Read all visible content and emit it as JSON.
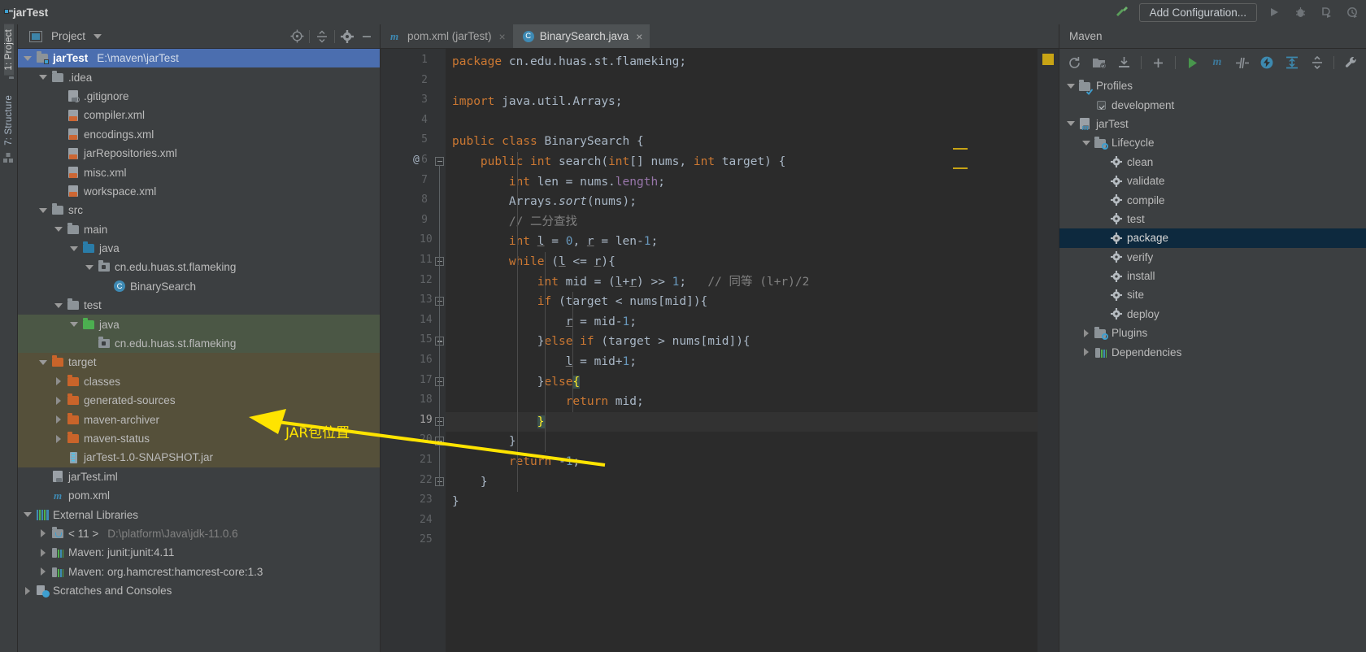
{
  "titlebar": {
    "project_name": "jarTest",
    "add_configuration_label": "Add Configuration...",
    "icons": [
      "build-hammer-icon",
      "run-icon",
      "debug-icon",
      "run-with-coverage-icon",
      "profiler-icon"
    ]
  },
  "left_strip": {
    "tabs": [
      {
        "label": "1: Project",
        "active": true
      },
      {
        "label": "7: Structure",
        "active": false
      }
    ]
  },
  "project_panel": {
    "title": "Project",
    "toolbar_icons": [
      "locate-target-icon",
      "collapse-all-icon",
      "settings-gear-icon",
      "hide-minus-icon"
    ],
    "tree": [
      {
        "depth": 0,
        "twisty": "down",
        "icon": "module-folder-icon",
        "label": "jarTest",
        "sub": "E:\\maven\\jarTest",
        "selected": true,
        "bold": true
      },
      {
        "depth": 1,
        "twisty": "down",
        "icon": "folder-icon",
        "label": ".idea",
        "sub": ""
      },
      {
        "depth": 2,
        "twisty": "none",
        "icon": "gitignore-file-icon",
        "label": ".gitignore",
        "sub": ""
      },
      {
        "depth": 2,
        "twisty": "none",
        "icon": "xml-file-icon",
        "label": "compiler.xml",
        "sub": ""
      },
      {
        "depth": 2,
        "twisty": "none",
        "icon": "xml-file-icon",
        "label": "encodings.xml",
        "sub": ""
      },
      {
        "depth": 2,
        "twisty": "none",
        "icon": "xml-file-icon",
        "label": "jarRepositories.xml",
        "sub": ""
      },
      {
        "depth": 2,
        "twisty": "none",
        "icon": "xml-file-icon",
        "label": "misc.xml",
        "sub": ""
      },
      {
        "depth": 2,
        "twisty": "none",
        "icon": "xml-file-icon",
        "label": "workspace.xml",
        "sub": ""
      },
      {
        "depth": 1,
        "twisty": "down",
        "icon": "folder-icon",
        "label": "src",
        "sub": ""
      },
      {
        "depth": 2,
        "twisty": "down",
        "icon": "folder-icon",
        "label": "main",
        "sub": ""
      },
      {
        "depth": 3,
        "twisty": "down",
        "icon": "source-root-folder-icon",
        "label": "java",
        "sub": ""
      },
      {
        "depth": 4,
        "twisty": "down",
        "icon": "package-icon",
        "label": "cn.edu.huas.st.flameking",
        "sub": ""
      },
      {
        "depth": 5,
        "twisty": "none",
        "icon": "java-class-icon",
        "label": "BinarySearch",
        "sub": ""
      },
      {
        "depth": 2,
        "twisty": "down",
        "icon": "folder-icon",
        "label": "test",
        "sub": ""
      },
      {
        "depth": 3,
        "twisty": "down",
        "icon": "test-source-root-folder-icon",
        "label": "java",
        "sub": "",
        "highlight": "green"
      },
      {
        "depth": 4,
        "twisty": "none",
        "icon": "package-icon",
        "label": "cn.edu.huas.st.flameking",
        "sub": "",
        "highlight": "green"
      },
      {
        "depth": 1,
        "twisty": "down",
        "icon": "excluded-folder-icon",
        "label": "target",
        "sub": "",
        "highlight": "brown"
      },
      {
        "depth": 2,
        "twisty": "right",
        "icon": "excluded-folder-icon",
        "label": "classes",
        "sub": "",
        "highlight": "brown"
      },
      {
        "depth": 2,
        "twisty": "right",
        "icon": "excluded-folder-icon",
        "label": "generated-sources",
        "sub": "",
        "highlight": "brown"
      },
      {
        "depth": 2,
        "twisty": "right",
        "icon": "excluded-folder-icon",
        "label": "maven-archiver",
        "sub": "",
        "highlight": "brown"
      },
      {
        "depth": 2,
        "twisty": "right",
        "icon": "excluded-folder-icon",
        "label": "maven-status",
        "sub": "",
        "highlight": "brown"
      },
      {
        "depth": 2,
        "twisty": "none",
        "icon": "jar-file-icon",
        "label": "jarTest-1.0-SNAPSHOT.jar",
        "sub": "",
        "highlight": "brown"
      },
      {
        "depth": 1,
        "twisty": "none",
        "icon": "iml-module-file-icon",
        "label": "jarTest.iml",
        "sub": ""
      },
      {
        "depth": 1,
        "twisty": "none",
        "icon": "maven-pom-icon",
        "label": "pom.xml",
        "sub": ""
      },
      {
        "depth": 0,
        "twisty": "down",
        "icon": "external-libraries-icon",
        "label": "External Libraries",
        "sub": ""
      },
      {
        "depth": 1,
        "twisty": "right",
        "icon": "jdk-icon",
        "label": "< 11 >",
        "sub": "D:\\platform\\Java\\jdk-11.0.6"
      },
      {
        "depth": 1,
        "twisty": "right",
        "icon": "maven-library-icon",
        "label": "Maven: junit:junit:4.11",
        "sub": ""
      },
      {
        "depth": 1,
        "twisty": "right",
        "icon": "maven-library-icon",
        "label": "Maven: org.hamcrest:hamcrest-core:1.3",
        "sub": ""
      },
      {
        "depth": 0,
        "twisty": "right",
        "icon": "scratches-icon",
        "label": "Scratches and Consoles",
        "sub": ""
      }
    ]
  },
  "annotation": {
    "text": "JAR包位置",
    "color": "#ffe400"
  },
  "editor": {
    "tabs": [
      {
        "label": "pom.xml (jarTest)",
        "icon": "maven-pom-icon",
        "active": false,
        "close": "×"
      },
      {
        "label": "BinarySearch.java",
        "icon": "java-class-icon",
        "active": true,
        "close": "×"
      }
    ],
    "current_line": 19,
    "line_numbers": [
      1,
      2,
      3,
      4,
      5,
      6,
      7,
      8,
      9,
      10,
      11,
      12,
      13,
      14,
      15,
      16,
      17,
      18,
      19,
      20,
      21,
      22,
      23,
      24,
      25
    ],
    "gutter_annotation_line": 6,
    "gutter_annotation_glyph": "@",
    "fold_lines": [
      6,
      11,
      13,
      15,
      17,
      19,
      20,
      22
    ],
    "code_lines": [
      {
        "n": 1,
        "tokens": [
          {
            "t": "package ",
            "c": "k"
          },
          {
            "t": "cn.edu.huas.st.flameking;",
            "c": "id"
          }
        ]
      },
      {
        "n": 2,
        "tokens": []
      },
      {
        "n": 3,
        "tokens": [
          {
            "t": "import ",
            "c": "k"
          },
          {
            "t": "java.util.Arrays;",
            "c": "id"
          }
        ]
      },
      {
        "n": 4,
        "tokens": []
      },
      {
        "n": 5,
        "tokens": [
          {
            "t": "public class ",
            "c": "k"
          },
          {
            "t": "BinarySearch",
            "c": "cls"
          },
          {
            "t": " {",
            "c": "id"
          }
        ]
      },
      {
        "n": 6,
        "tokens": [
          {
            "t": "    public int ",
            "c": "k"
          },
          {
            "t": "search",
            "c": "cls"
          },
          {
            "t": "(",
            "c": "id"
          },
          {
            "t": "int",
            "c": "k"
          },
          {
            "t": "[] nums, ",
            "c": "id"
          },
          {
            "t": "int",
            "c": "k"
          },
          {
            "t": " target) {",
            "c": "id"
          }
        ]
      },
      {
        "n": 7,
        "tokens": [
          {
            "t": "        int",
            "c": "k"
          },
          {
            "t": " len = nums.",
            "c": "id"
          },
          {
            "t": "length",
            "c": "fld"
          },
          {
            "t": ";",
            "c": "id"
          }
        ]
      },
      {
        "n": 8,
        "tokens": [
          {
            "t": "        Arrays.",
            "c": "id"
          },
          {
            "t": "sort",
            "c": "id-italic"
          },
          {
            "t": "(nums);",
            "c": "id"
          }
        ]
      },
      {
        "n": 9,
        "tokens": [
          {
            "t": "        // 二分查找",
            "c": "cm"
          }
        ]
      },
      {
        "n": 10,
        "tokens": [
          {
            "t": "        int",
            "c": "k"
          },
          {
            "t": " ",
            "c": "id"
          },
          {
            "t": "l",
            "c": "u"
          },
          {
            "t": " = ",
            "c": "id"
          },
          {
            "t": "0",
            "c": "num"
          },
          {
            "t": ", ",
            "c": "id"
          },
          {
            "t": "r",
            "c": "u"
          },
          {
            "t": " = len-",
            "c": "id"
          },
          {
            "t": "1",
            "c": "num"
          },
          {
            "t": ";",
            "c": "id"
          }
        ]
      },
      {
        "n": 11,
        "tokens": [
          {
            "t": "        while",
            "c": "k"
          },
          {
            "t": " (",
            "c": "id"
          },
          {
            "t": "l",
            "c": "u"
          },
          {
            "t": " <= ",
            "c": "id"
          },
          {
            "t": "r",
            "c": "u"
          },
          {
            "t": "){",
            "c": "id"
          }
        ]
      },
      {
        "n": 12,
        "tokens": [
          {
            "t": "            int",
            "c": "k"
          },
          {
            "t": " mid = (",
            "c": "id"
          },
          {
            "t": "l",
            "c": "u"
          },
          {
            "t": "+",
            "c": "id"
          },
          {
            "t": "r",
            "c": "u"
          },
          {
            "t": ") >> ",
            "c": "id"
          },
          {
            "t": "1",
            "c": "num"
          },
          {
            "t": ";   ",
            "c": "id"
          },
          {
            "t": "// 同等 (l+r)/2",
            "c": "cm"
          }
        ]
      },
      {
        "n": 13,
        "tokens": [
          {
            "t": "            if",
            "c": "k"
          },
          {
            "t": " (target < nums[mid]){",
            "c": "id"
          }
        ]
      },
      {
        "n": 14,
        "tokens": [
          {
            "t": "                ",
            "c": "id"
          },
          {
            "t": "r",
            "c": "u"
          },
          {
            "t": " = mid-",
            "c": "id"
          },
          {
            "t": "1",
            "c": "num"
          },
          {
            "t": ";",
            "c": "id"
          }
        ]
      },
      {
        "n": 15,
        "tokens": [
          {
            "t": "            }",
            "c": "id"
          },
          {
            "t": "else if",
            "c": "k"
          },
          {
            "t": " (target > nums[mid]){",
            "c": "id"
          }
        ]
      },
      {
        "n": 16,
        "tokens": [
          {
            "t": "                ",
            "c": "id"
          },
          {
            "t": "l",
            "c": "u"
          },
          {
            "t": " = mid+",
            "c": "id"
          },
          {
            "t": "1",
            "c": "num"
          },
          {
            "t": ";",
            "c": "id"
          }
        ]
      },
      {
        "n": 17,
        "tokens": [
          {
            "t": "            }",
            "c": "id"
          },
          {
            "t": "else",
            "c": "k"
          },
          {
            "t": "{",
            "c": "bh"
          }
        ]
      },
      {
        "n": 18,
        "tokens": [
          {
            "t": "                return",
            "c": "k"
          },
          {
            "t": " mid;",
            "c": "id"
          }
        ]
      },
      {
        "n": 19,
        "tokens": [
          {
            "t": "            ",
            "c": "id"
          },
          {
            "t": "}",
            "c": "bh"
          }
        ]
      },
      {
        "n": 20,
        "tokens": [
          {
            "t": "        }",
            "c": "id"
          }
        ]
      },
      {
        "n": 21,
        "tokens": [
          {
            "t": "        return",
            "c": "k"
          },
          {
            "t": " -",
            "c": "id"
          },
          {
            "t": "1",
            "c": "num"
          },
          {
            "t": ";",
            "c": "id"
          }
        ]
      },
      {
        "n": 22,
        "tokens": [
          {
            "t": "    }",
            "c": "id"
          }
        ]
      },
      {
        "n": 23,
        "tokens": [
          {
            "t": "}",
            "c": "id"
          }
        ]
      },
      {
        "n": 24,
        "tokens": []
      },
      {
        "n": 25,
        "tokens": []
      }
    ]
  },
  "maven_panel": {
    "title": "Maven",
    "toolbar_icons": [
      "reload-icon",
      "add-managed-project-icon",
      "download-sources-icon",
      "plus-icon",
      "execute-goal-icon",
      "maven-m-icon",
      "toggle-skip-tests-icon",
      "offline-mode-icon",
      "expand-all-icon",
      "collapse-all-icon",
      "settings-wrench-icon"
    ],
    "tree": [
      {
        "depth": 0,
        "twisty": "down",
        "icon": "profiles-folder-icon",
        "label": "Profiles"
      },
      {
        "depth": 1,
        "twisty": "none",
        "icon": "checkbox-checked-icon",
        "label": "development"
      },
      {
        "depth": 0,
        "twisty": "down",
        "icon": "maven-project-icon",
        "label": "jarTest"
      },
      {
        "depth": 1,
        "twisty": "down",
        "icon": "lifecycle-folder-icon",
        "label": "Lifecycle"
      },
      {
        "depth": 2,
        "twisty": "none",
        "icon": "goal-gear-icon",
        "label": "clean"
      },
      {
        "depth": 2,
        "twisty": "none",
        "icon": "goal-gear-icon",
        "label": "validate"
      },
      {
        "depth": 2,
        "twisty": "none",
        "icon": "goal-gear-icon",
        "label": "compile"
      },
      {
        "depth": 2,
        "twisty": "none",
        "icon": "goal-gear-icon",
        "label": "test"
      },
      {
        "depth": 2,
        "twisty": "none",
        "icon": "goal-gear-icon",
        "label": "package",
        "selected": true
      },
      {
        "depth": 2,
        "twisty": "none",
        "icon": "goal-gear-icon",
        "label": "verify"
      },
      {
        "depth": 2,
        "twisty": "none",
        "icon": "goal-gear-icon",
        "label": "install"
      },
      {
        "depth": 2,
        "twisty": "none",
        "icon": "goal-gear-icon",
        "label": "site"
      },
      {
        "depth": 2,
        "twisty": "none",
        "icon": "goal-gear-icon",
        "label": "deploy"
      },
      {
        "depth": 1,
        "twisty": "right",
        "icon": "plugins-folder-icon",
        "label": "Plugins"
      },
      {
        "depth": 1,
        "twisty": "right",
        "icon": "dependencies-icon",
        "label": "Dependencies"
      }
    ]
  },
  "colors": {
    "background": "#3c3f41",
    "editor_background": "#2b2b2b",
    "selection_blue": "#4b6eaf",
    "maven_selection": "#0d293e",
    "accent_yellow": "#ffe400",
    "keyword_orange": "#cc7832",
    "number_blue": "#6897bb",
    "comment_gray": "#808080"
  }
}
